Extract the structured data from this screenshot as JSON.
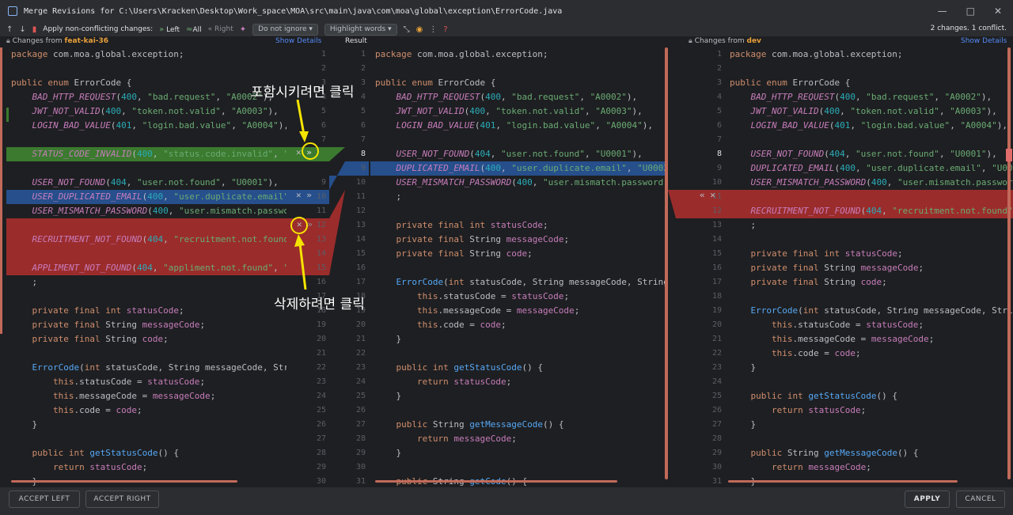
{
  "window": {
    "title": "Merge Revisions for C:\\Users\\Kracken\\Desktop\\Work_space\\MOA\\src\\main\\java\\com\\moa\\global\\exception\\ErrorCode.java",
    "minimize": "—",
    "maximize": "□",
    "close": "✕"
  },
  "toolbar": {
    "apply_label": "Apply non-conflicting changes:",
    "left_label": "Left",
    "all_label": "All",
    "right_label": "Right",
    "ignore_select": "Do not ignore",
    "highlight_select": "Highlight words",
    "status": "2 changes. 1 conflict."
  },
  "headers": {
    "left_prefix": "Changes from",
    "left_branch": "feat-kai-36",
    "left_show": "Show Details",
    "result": "Result",
    "right_prefix": "Changes from",
    "right_branch": "dev",
    "right_show": "Show Details"
  },
  "left": {
    "lines": [
      "package com.moa.global.exception;",
      "",
      "public enum ErrorCode {",
      "    BAD_HTTP_REQUEST(400, \"bad.request\", \"A0002\"),",
      "    JWT_NOT_VALID(400, \"token.not.valid\", \"A0003\"),",
      "    LOGIN_BAD_VALUE(401, \"login.bad.value\", \"A0004\"),",
      "",
      "    STATUS_CODE_INVALID(400, \"status.code.invalid\", \"S0001",
      "",
      "    USER_NOT_FOUND(404, \"user.not.found\", \"U0001\"),",
      "    USER_DUPLICATED_EMAIL(400, \"user.duplicate.email\", \"U0",
      "    USER_MISMATCH_PASSWORD(400, \"user.mismatch.password\",",
      "",
      "    RECRUITMENT_NOT_FOUND(404, \"recruitment.not.found\", \"R",
      "",
      "    APPLIMENT_NOT_FOUND(404, \"appliment.not.found\", \"P0001",
      "    ;",
      "",
      "    private final int statusCode;",
      "    private final String messageCode;",
      "    private final String code;",
      "",
      "    ErrorCode(int statusCode, String messageCode, String c",
      "        this.statusCode = statusCode;",
      "        this.messageCode = messageCode;",
      "        this.code = code;",
      "    }",
      "",
      "    public int getStatusCode() {",
      "        return statusCode;",
      "    }"
    ],
    "line_numbers": [
      "1",
      "2",
      "3",
      "4",
      "5",
      "6",
      "7",
      "",
      "",
      "9",
      "10",
      "11",
      "12",
      "13",
      "14",
      "15",
      "16",
      "17",
      "18",
      "19",
      "20",
      "21",
      "22",
      "23",
      "24",
      "25",
      "26",
      "27",
      "28",
      "29",
      "30",
      "31"
    ]
  },
  "result": {
    "lines": [
      "package com.moa.global.exception;",
      "",
      "public enum ErrorCode {",
      "    BAD_HTTP_REQUEST(400, \"bad.request\", \"A0002\"),",
      "    JWT_NOT_VALID(400, \"token.not.valid\", \"A0003\"),",
      "    LOGIN_BAD_VALUE(401, \"login.bad.value\", \"A0004\"),",
      "",
      "    USER_NOT_FOUND(404, \"user.not.found\", \"U0001\"),",
      "    DUPLICATED_EMAIL(400, \"user.duplicate.email\", \"U0002\"),",
      "    USER_MISMATCH_PASSWORD(400, \"user.mismatch.password\", \"U00",
      "    ;",
      "",
      "    private final int statusCode;",
      "    private final String messageCode;",
      "    private final String code;",
      "",
      "    ErrorCode(int statusCode, String messageCode, String code)",
      "        this.statusCode = statusCode;",
      "        this.messageCode = messageCode;",
      "        this.code = code;",
      "    }",
      "",
      "    public int getStatusCode() {",
      "        return statusCode;",
      "    }",
      "",
      "    public String getMessageCode() {",
      "        return messageCode;",
      "    }",
      "",
      "    public String getCode() {"
    ],
    "left_numbers": [
      "1",
      "2",
      "3",
      "4",
      "5",
      "6",
      "7",
      "8",
      "9",
      "10",
      "11",
      "12",
      "13",
      "14",
      "15",
      "16",
      "17",
      "18",
      "19",
      "20",
      "21",
      "22",
      "23",
      "24",
      "25",
      "26",
      "27",
      "28",
      "29",
      "30",
      "31"
    ],
    "right_numbers": [
      "1",
      "2",
      "3",
      "4",
      "5",
      "6",
      "7",
      "8",
      "9",
      "10",
      "11",
      "12",
      "13",
      "14",
      "15",
      "16",
      "17",
      "18",
      "19",
      "20",
      "21",
      "22",
      "23",
      "24",
      "25",
      "26",
      "27",
      "28",
      "29",
      "30",
      "31"
    ]
  },
  "right": {
    "lines": [
      "package com.moa.global.exception;",
      "",
      "public enum ErrorCode {",
      "    BAD_HTTP_REQUEST(400, \"bad.request\", \"A0002\"),",
      "    JWT_NOT_VALID(400, \"token.not.valid\", \"A0003\"),",
      "    LOGIN_BAD_VALUE(401, \"login.bad.value\", \"A0004\"),",
      "",
      "    USER_NOT_FOUND(404, \"user.not.found\", \"U0001\"),",
      "    DUPLICATED_EMAIL(400, \"user.duplicate.email\", \"U0002\"),",
      "    USER_MISMATCH_PASSWORD(400, \"user.mismatch.password\", \"U",
      "",
      "    RECRUITMENT_NOT_FOUND(404, \"recruitment.not.found\", \"R00",
      "    ;",
      "",
      "    private final int statusCode;",
      "    private final String messageCode;",
      "    private final String code;",
      "",
      "    ErrorCode(int statusCode, String messageCode, String cod",
      "        this.statusCode = statusCode;",
      "        this.messageCode = messageCode;",
      "        this.code = code;",
      "    }",
      "",
      "    public int getStatusCode() {",
      "        return statusCode;",
      "    }",
      "",
      "    public String getMessageCode() {",
      "        return messageCode;",
      "    }"
    ],
    "line_numbers": [
      "1",
      "2",
      "3",
      "4",
      "5",
      "6",
      "7",
      "8",
      "9",
      "10",
      "11",
      "",
      "12",
      "13",
      "14",
      "15",
      "16",
      "17",
      "18",
      "19",
      "20",
      "21",
      "22",
      "23",
      "24",
      "25",
      "26",
      "27",
      "28",
      "29",
      "30"
    ]
  },
  "annotations": {
    "include": "포함시키려면 클릭",
    "delete": "삭제하려면 클릭"
  },
  "footer": {
    "accept_left": "ACCEPT LEFT",
    "accept_right": "ACCEPT RIGHT",
    "apply": "APPLY",
    "cancel": "CANCEL"
  },
  "colors": {
    "added": "#3b7a2f",
    "modified": "#264f8c",
    "conflict": "#9b2c2c",
    "annotation": "#f5e400"
  }
}
